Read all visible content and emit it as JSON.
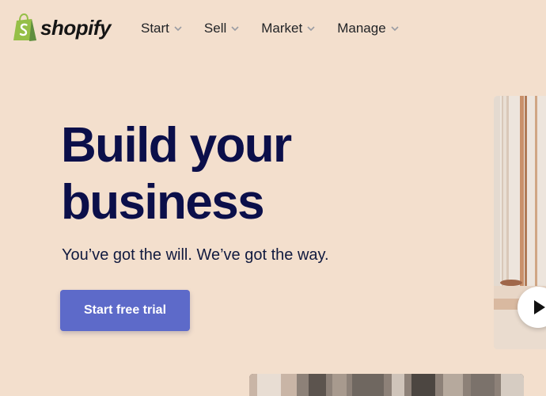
{
  "header": {
    "logo_text": "shopify",
    "logo_icon": "shopify-bag-icon",
    "nav": [
      {
        "label": "Start"
      },
      {
        "label": "Sell"
      },
      {
        "label": "Market"
      },
      {
        "label": "Manage"
      }
    ]
  },
  "hero": {
    "title_line1": "Build your",
    "title_line2": "business",
    "subtitle": "You’ve got the will. We’ve got the way.",
    "cta_label": "Start free trial"
  },
  "colors": {
    "background": "#f3dfcd",
    "heading": "#0b0f4a",
    "cta": "#5d6ac9",
    "logo_green": "#95bf47"
  }
}
